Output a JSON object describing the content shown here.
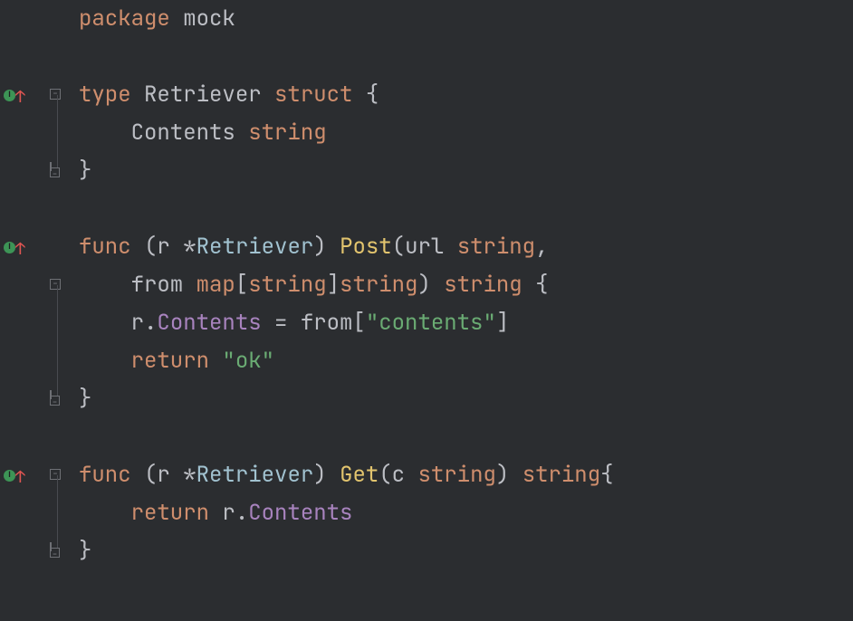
{
  "code": {
    "line1": {
      "package_kw": "package",
      "package_name": "mock"
    },
    "line3": {
      "type_kw": "type",
      "type_name": "Retriever",
      "struct_kw": "struct",
      "brace": "{"
    },
    "line4": {
      "field": "Contents",
      "field_type": "string"
    },
    "line5": {
      "brace": "}"
    },
    "line7": {
      "func_kw": "func",
      "receiver_open": "(",
      "receiver_var": "r",
      "receiver_star": "*",
      "receiver_type": "Retriever",
      "receiver_close": ")",
      "func_name": "Post",
      "param_open": "(",
      "param1_name": "url",
      "param1_type": "string",
      "comma": ","
    },
    "line8": {
      "param2_name": "from",
      "map_kw": "map",
      "bracket_open": "[",
      "key_type": "string",
      "bracket_close": "]",
      "val_type": "string",
      "param_close": ")",
      "return_type": "string",
      "brace": "{"
    },
    "line9": {
      "receiver": "r",
      "dot": ".",
      "field": "Contents",
      "eq": "=",
      "var": "from",
      "bracket_open": "[",
      "key": "\"contents\"",
      "bracket_close": "]"
    },
    "line10": {
      "return_kw": "return",
      "value": "\"ok\""
    },
    "line11": {
      "brace": "}"
    },
    "line13": {
      "func_kw": "func",
      "receiver_open": "(",
      "receiver_var": "r",
      "receiver_star": "*",
      "receiver_type": "Retriever",
      "receiver_close": ")",
      "func_name": "Get",
      "param_open": "(",
      "param_name": "c",
      "param_type": "string",
      "param_close": ")",
      "return_type": "string",
      "brace": "{"
    },
    "line14": {
      "return_kw": "return",
      "receiver": "r",
      "dot": ".",
      "field": "Contents"
    },
    "line15": {
      "brace": "}"
    }
  }
}
